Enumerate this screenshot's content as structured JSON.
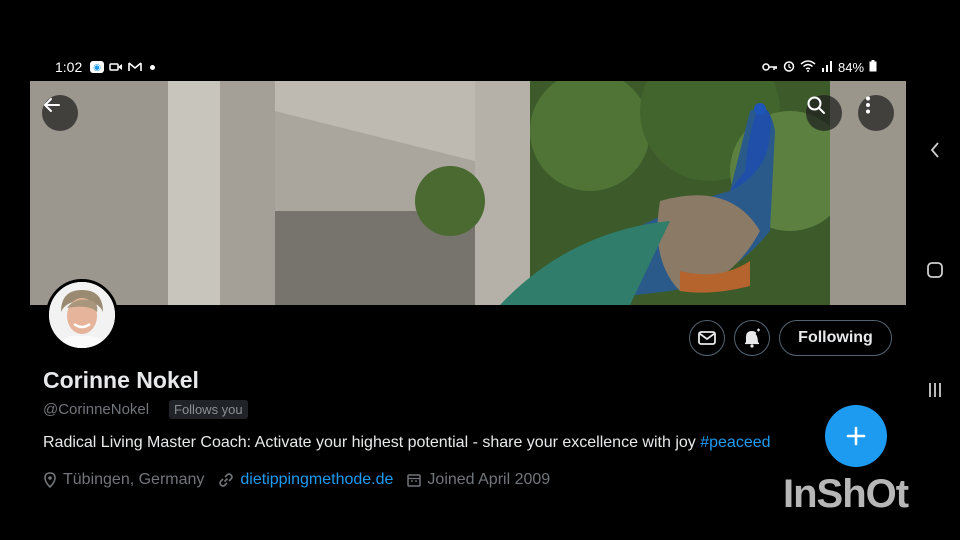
{
  "status_bar": {
    "time": "1:02",
    "battery": "84%",
    "left_icons": [
      "app-icon",
      "video-icon",
      "gmail-icon",
      "notification-dot"
    ],
    "right_icons": [
      "key-icon",
      "alarm-icon",
      "wifi-icon",
      "signal-icon",
      "battery-icon"
    ]
  },
  "banner": {
    "back_icon": "arrow-left-icon",
    "search_icon": "search-icon",
    "more_icon": "more-vertical-icon"
  },
  "profile": {
    "name": "Corinne Nokel",
    "handle": "@CorinneNokel",
    "follows_you": "Follows you",
    "bio_text": "Radical Living Master Coach: Activate your highest potential - share your excellence with joy ",
    "bio_hashtag": "#peaceed",
    "location": "Tübingen, Germany",
    "website": "dietippingmethode.de",
    "joined": "Joined April 2009"
  },
  "actions": {
    "message_icon": "mail-icon",
    "notify_icon": "bell-plus-icon",
    "following_label": "Following"
  },
  "fab": {
    "icon": "plus-icon"
  },
  "nav": {
    "back": "chevron-left-icon",
    "home": "home-square-icon",
    "recents": "recents-icon"
  },
  "watermark": "InShOt",
  "colors": {
    "accent": "#1d9bf0",
    "background": "#000000",
    "text": "#e7e9ea",
    "muted": "#71767b"
  }
}
